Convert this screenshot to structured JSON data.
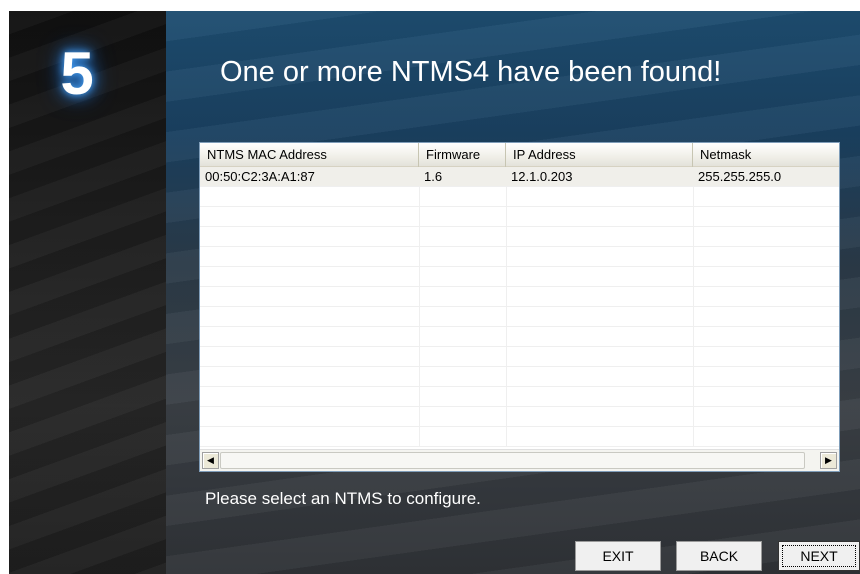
{
  "wizard": {
    "step_number": "5",
    "headline": "One or more NTMS4 have been found!",
    "status_text": "Please select an NTMS to configure."
  },
  "device_list": {
    "columns": [
      "NTMS MAC Address",
      "Firmware",
      "IP Address",
      "Netmask"
    ],
    "rows": [
      [
        "00:50:C2:3A:A1:87",
        "1.6",
        "12.1.0.203",
        "255.255.255.0"
      ]
    ],
    "scroll_left_glyph": "◀",
    "scroll_right_glyph": "▶"
  },
  "buttons": {
    "exit": "EXIT",
    "back": "BACK",
    "next": "NEXT"
  },
  "colors": {
    "header_blue": "#1d4d70",
    "step_glow": "#4aa8ff"
  }
}
